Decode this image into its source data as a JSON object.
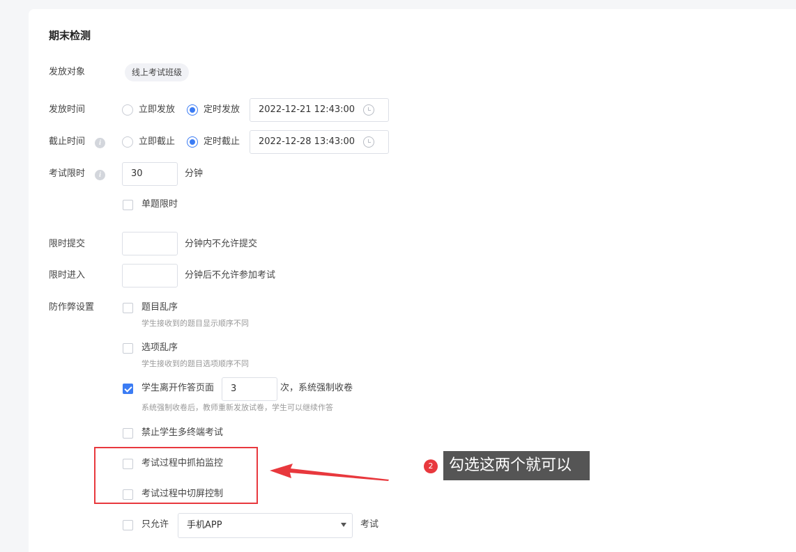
{
  "form": {
    "title": "期末检测",
    "target": {
      "label": "发放对象",
      "tag": "线上考试班级"
    },
    "release_time": {
      "label": "发放时间",
      "option_now": "立即发放",
      "option_scheduled": "定时发放",
      "selected": "定时发放",
      "datetime": "2022-12-21 12:43:00"
    },
    "deadline": {
      "label": "截止时间",
      "option_now": "立即截止",
      "option_scheduled": "定时截止",
      "selected": "定时截止",
      "datetime": "2022-12-28 13:43:00"
    },
    "time_limit": {
      "label": "考试限时",
      "value": "30",
      "unit": "分钟",
      "per_question_label": "单题限时",
      "per_question_checked": false
    },
    "submit_limit": {
      "label": "限时提交",
      "value": "",
      "suffix": "分钟内不允许提交"
    },
    "entry_limit": {
      "label": "限时进入",
      "value": "",
      "suffix": "分钟后不允许参加考试"
    },
    "anti_cheat": {
      "label": "防作弊设置",
      "shuffle_questions": {
        "label": "题目乱序",
        "hint": "学生接收到的题目显示顺序不同",
        "checked": false
      },
      "shuffle_options": {
        "label": "选项乱序",
        "hint": "学生接收到的题目选项顺序不同",
        "checked": false
      },
      "leave_page": {
        "label_prefix": "学生离开作答页面",
        "value": "3",
        "label_suffix": "次，系统强制收卷",
        "hint": "系统强制收卷后，教师重新发放试卷，学生可以继续作答",
        "checked": true
      },
      "multi_device": {
        "label": "禁止学生多终端考试",
        "checked": false
      },
      "snapshot": {
        "label": "考试过程中抓拍监控",
        "checked": false
      },
      "screen_switch": {
        "label": "考试过程中切屏控制",
        "checked": false
      },
      "only_allow": {
        "label": "只允许",
        "selected": "手机APP",
        "suffix": "考试",
        "checked": false
      }
    }
  },
  "annotation": {
    "badge": "2",
    "text": "勾选这两个就可以",
    "color": "#e8383d"
  },
  "icons": {
    "info": "info-icon",
    "clock": "clock-icon",
    "dropdown": "caret-down-icon"
  },
  "colors": {
    "primary": "#3b7cf4",
    "highlight": "#e8383d",
    "callout_bg": "#555555"
  }
}
